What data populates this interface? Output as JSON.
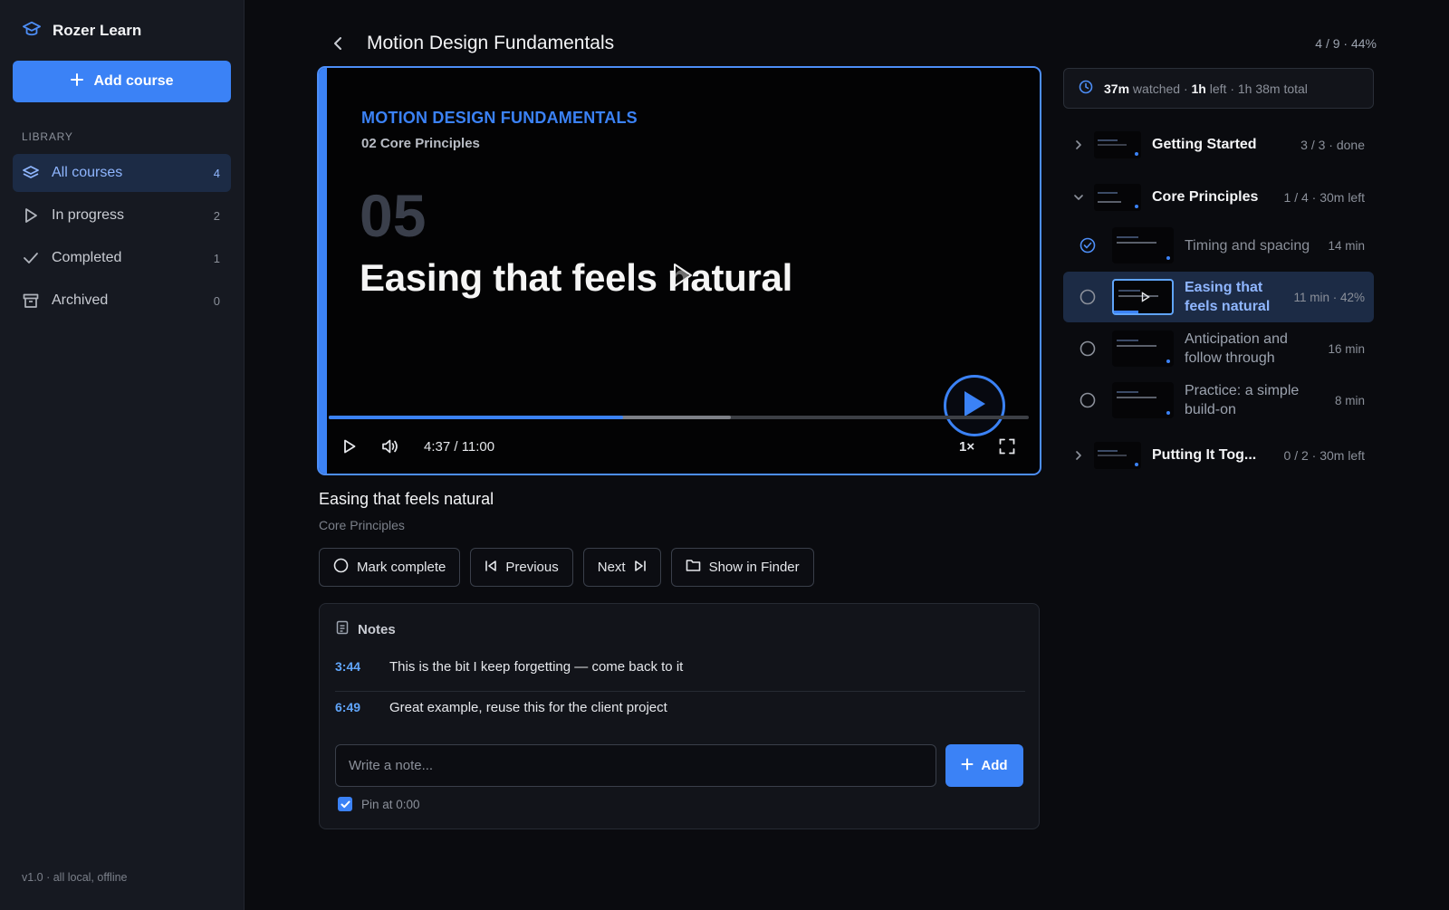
{
  "app": {
    "name": "Rozer Learn",
    "version": "v1.0 · all local, offline"
  },
  "sidebar": {
    "add_course_label": "Add course",
    "library_label": "LIBRARY",
    "items": [
      {
        "label": "All courses",
        "count": "4",
        "icon": "layers-icon",
        "active": true
      },
      {
        "label": "In progress",
        "count": "2",
        "icon": "play-outline-icon",
        "active": false
      },
      {
        "label": "Completed",
        "count": "1",
        "icon": "check-icon",
        "active": false
      },
      {
        "label": "Archived",
        "count": "0",
        "icon": "archive-icon",
        "active": false
      }
    ]
  },
  "header": {
    "title": "Motion Design Fundamentals",
    "progress": "4 / 9 · 44%"
  },
  "video": {
    "course_label": "MOTION DESIGN FUNDAMENTALS",
    "section_label": "02 Core Principles",
    "lesson_number": "05",
    "lesson_title": "Easing that feels natural",
    "time": "4:37 / 11:00",
    "played_fraction": 0.42,
    "buffered_fraction": 0.575,
    "speed": "1×"
  },
  "lesson": {
    "title": "Easing that feels natural",
    "section": "Core Principles",
    "actions": {
      "mark_complete": "Mark complete",
      "previous": "Previous",
      "next": "Next",
      "show_in_finder": "Show in Finder"
    }
  },
  "notes": {
    "heading": "Notes",
    "items": [
      {
        "time": "3:44",
        "text": "This is the bit I keep forgetting — come back to it"
      },
      {
        "time": "6:49",
        "text": "Great example, reuse this for the client project"
      }
    ],
    "input_placeholder": "Write a note...",
    "add_label": "Add",
    "pin_label": "Pin at 0:00",
    "pin_checked": true
  },
  "watch_stats": {
    "watched": "37m",
    "watched_label": "watched ·",
    "left": "1h",
    "left_label": "left · 1h 38m total"
  },
  "sections": [
    {
      "title": "Getting Started",
      "meta": "3 / 3 · done",
      "expanded": false
    },
    {
      "title": "Core Principles",
      "meta": "1 / 4 · 30m left",
      "expanded": true,
      "lessons": [
        {
          "title": "Timing and spacing",
          "meta": "14 min",
          "status": "done"
        },
        {
          "title": "Easing that feels natural",
          "meta": "11 min · 42%",
          "status": "current",
          "progress": 0.42
        },
        {
          "title": "Anticipation and follow through",
          "meta": "16 min",
          "status": "todo"
        },
        {
          "title": "Practice: a simple build-on",
          "meta": "8 min",
          "status": "todo"
        }
      ]
    },
    {
      "title": "Putting It Tog...",
      "meta": "0 / 2 · 30m left",
      "expanded": false
    }
  ],
  "colors": {
    "accent": "#3b82f6",
    "accent_light": "#8fb6ff",
    "background": "#0a0b0f",
    "sidebar": "#161921"
  }
}
